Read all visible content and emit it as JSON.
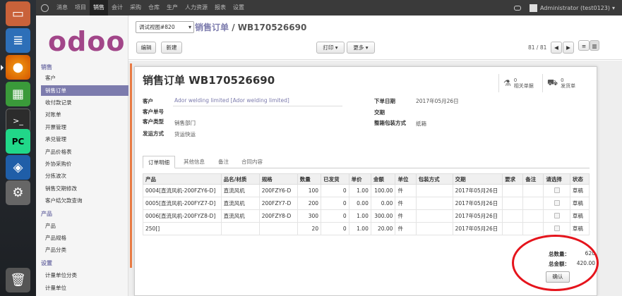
{
  "launcher": {
    "icons": [
      "files-icon",
      "writer-icon",
      "firefox-icon",
      "calc-icon",
      "terminal-icon",
      "pycharm-icon",
      "virtualbox-icon",
      "settings-icon",
      "trash-icon"
    ]
  },
  "topbar": {
    "menu": [
      "消息",
      "项目",
      "销售",
      "会计",
      "采购",
      "仓库",
      "生产",
      "人力资源",
      "报表",
      "设置"
    ],
    "active_index": 2,
    "user": "Administrator (test0123)"
  },
  "sidebar": {
    "logo": "odoo",
    "sections": [
      {
        "title": "销售",
        "items": [
          "客户",
          "销售订单",
          "收付款记录",
          "对账单",
          "开票管理",
          "承兑管理",
          "产品价格表",
          "外协采购价",
          "分拣波次",
          "销售交期修改",
          "客户结欠款查询"
        ]
      },
      {
        "title": "产品",
        "items": [
          "产品",
          "产品规格",
          "产品分类"
        ]
      },
      {
        "title": "设置",
        "items": [
          "计量单位分类",
          "计量单位"
        ]
      }
    ],
    "active_item": "销售订单"
  },
  "control_panel": {
    "view_select": "调试视图#820",
    "breadcrumb_parent": "销售订单",
    "breadcrumb_sep": " / ",
    "breadcrumb_current": "WB170526690",
    "edit_label": "编辑",
    "create_label": "新建",
    "print_label": "打印",
    "more_label": "更多",
    "pager": "81 / 81"
  },
  "sheet": {
    "title": "销售订单 WB170526690",
    "smart_buttons": [
      {
        "count": "0",
        "label": "相关单据",
        "icon": "flask-icon"
      },
      {
        "count": "0",
        "label": "发货单",
        "icon": "truck-icon"
      }
    ],
    "fields_left": [
      {
        "label": "客户",
        "value": "Ador welding limited [Ador welding limited]"
      },
      {
        "label": "客户单号",
        "value": ""
      },
      {
        "label": "客户类型",
        "value": "销售部门"
      },
      {
        "label": "发运方式",
        "value": "货运快运"
      }
    ],
    "fields_right": [
      {
        "label": "下单日期",
        "value": "2017年05月26日"
      },
      {
        "label": "交期",
        "value": ""
      },
      {
        "label": "整箱包装方式",
        "value": "纸箱"
      }
    ],
    "tabs": [
      "订单明细",
      "其他信息",
      "备注",
      "合同内容"
    ],
    "active_tab": 0,
    "columns": [
      "产品",
      "品名/材质",
      "规格",
      "数量",
      "已发货",
      "单价",
      "金额",
      "单位",
      "包装方式",
      "交期",
      "要求",
      "备注",
      "请选择",
      "状态"
    ],
    "rows": [
      [
        "0004[直流风机-200FZY6-D]",
        "直流风机",
        "200FZY6-D",
        "100",
        "0",
        "1.00",
        "100.00",
        "件",
        "",
        "2017年05月26日",
        "",
        "",
        "",
        "草稿"
      ],
      [
        "0005[直流风机-200FYZ7-D]",
        "直流风机",
        "200FZY7-D",
        "200",
        "0",
        "0.00",
        "0.00",
        "件",
        "",
        "2017年05月26日",
        "",
        "",
        "",
        "草稿"
      ],
      [
        "0006[直流风机-200FYZ8-D]",
        "直流风机",
        "200FZY8-D",
        "300",
        "0",
        "1.00",
        "300.00",
        "件",
        "",
        "2017年05月26日",
        "",
        "",
        "",
        "草稿"
      ],
      [
        "250[]",
        "",
        "",
        "20",
        "0",
        "1.00",
        "20.00",
        "件",
        "",
        "2017年05月26日",
        "",
        "",
        "",
        "草稿"
      ]
    ],
    "totals": {
      "qty_label": "总数量：",
      "qty_value": "620",
      "amount_label": "总金额：",
      "amount_value": "420.00",
      "confirm_label": "确认"
    }
  },
  "colors": {
    "accent": "#7c7bad",
    "logo": "#a24689",
    "annotation": "#e5141c"
  }
}
